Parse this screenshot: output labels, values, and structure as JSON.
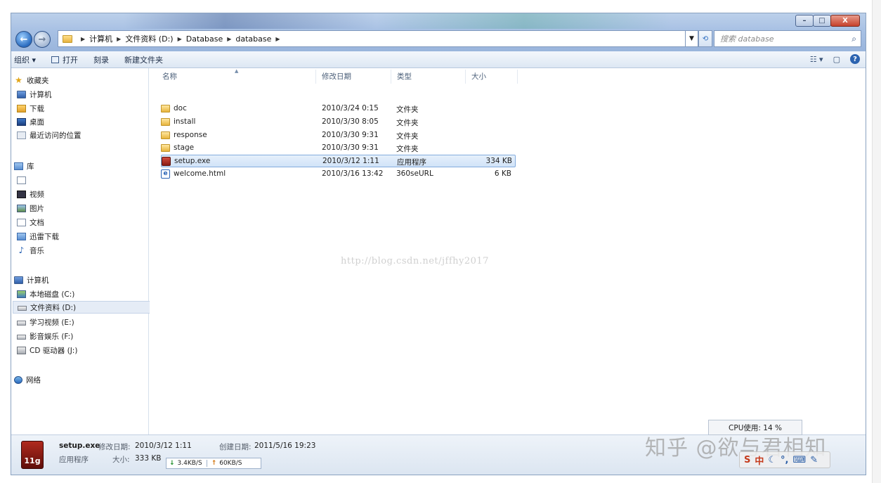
{
  "window": {
    "controls": {
      "minimize": "–",
      "maximize": "□",
      "close": "X"
    }
  },
  "address": {
    "segments": [
      "计算机",
      "文件资料 (D:)",
      "Database",
      "database"
    ],
    "search_placeholder": "搜索 database"
  },
  "toolbar": {
    "organize": "组织 ▾",
    "open": "打开",
    "burn": "刻录",
    "new_folder": "新建文件夹"
  },
  "nav": {
    "favorites": "收藏夹",
    "fav_items": [
      "计算机",
      "下载",
      "桌面",
      "最近访问的位置"
    ],
    "libraries": "库",
    "lib_items": [
      "视频",
      "图片",
      "文档",
      "迅雷下载",
      "音乐"
    ],
    "computer": "计算机",
    "drives": [
      "本地磁盘 (C:)",
      "文件资料 (D:)",
      "学习视频 (E:)",
      "影音娱乐 (F:)",
      "CD 驱动器 (J:)"
    ],
    "network": "网络"
  },
  "columns": {
    "name": "名称",
    "modified": "修改日期",
    "type": "类型",
    "size": "大小"
  },
  "files": [
    {
      "name": "doc",
      "modified": "2010/3/24 0:15",
      "type": "文件夹",
      "size": "",
      "icon": "folder-icon"
    },
    {
      "name": "install",
      "modified": "2010/3/30 8:05",
      "type": "文件夹",
      "size": "",
      "icon": "folder-icon"
    },
    {
      "name": "response",
      "modified": "2010/3/30 9:31",
      "type": "文件夹",
      "size": "",
      "icon": "folder-icon"
    },
    {
      "name": "stage",
      "modified": "2010/3/30 9:31",
      "type": "文件夹",
      "size": "",
      "icon": "folder-icon"
    },
    {
      "name": "setup.exe",
      "modified": "2010/3/12 1:11",
      "type": "应用程序",
      "size": "334 KB",
      "icon": "exe-icon"
    },
    {
      "name": "welcome.html",
      "modified": "2010/3/16 13:42",
      "type": "360seURL",
      "size": "6 KB",
      "icon": "html-icon"
    }
  ],
  "watermark_text": "http://blog.csdn.net/jffhy2017",
  "details": {
    "filename": "setup.exe",
    "modified_label": "修改日期:",
    "modified_value": "2010/3/12 1:11",
    "created_label": "创建日期:",
    "created_value": "2011/5/16 19:23",
    "type": "应用程序",
    "size_label": "大小:",
    "size_value": "333 KB",
    "thumb_text": "11g",
    "download_speed": "3.4KB/S",
    "upload_speed": "60KB/S",
    "cpu": "CPU使用: 14 %"
  },
  "overlay": {
    "zhihu_watermark": "知乎 @欲与君相知",
    "ime_text": "中"
  }
}
